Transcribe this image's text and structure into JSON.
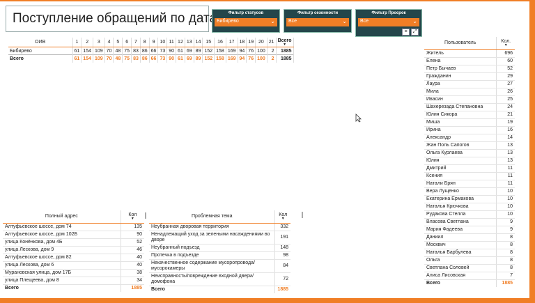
{
  "title": "Поступление обращений по датам",
  "filters": [
    {
      "label": "Фильтр статусов",
      "value": "Бибирево"
    },
    {
      "label": "Фильтр сезонности",
      "value": "Все"
    },
    {
      "label": "Фильтр Просрок",
      "value": "Все"
    }
  ],
  "main_table": {
    "row_header": "ОИВ",
    "columns": [
      "1",
      "2",
      "3",
      "4",
      "5",
      "6",
      "7",
      "8",
      "9",
      "10",
      "11",
      "12",
      "13",
      "14",
      "15",
      "16",
      "17",
      "18",
      "19",
      "20",
      "21",
      "Всего"
    ],
    "rows": [
      {
        "name": "Бибирево",
        "values": [
          "61",
          "154",
          "109",
          "70",
          "48",
          "75",
          "83",
          "86",
          "66",
          "73",
          "90",
          "61",
          "69",
          "89",
          "152",
          "158",
          "169",
          "94",
          "76",
          "100",
          "2",
          "1885"
        ]
      },
      {
        "name": "Всего",
        "values": [
          "61",
          "154",
          "109",
          "70",
          "48",
          "75",
          "83",
          "86",
          "66",
          "73",
          "90",
          "61",
          "69",
          "89",
          "152",
          "158",
          "169",
          "94",
          "76",
          "100",
          "2",
          "1885"
        ]
      }
    ]
  },
  "users_table": {
    "headers": [
      "Пользователь",
      "Кол."
    ],
    "rows": [
      [
        "Житель",
        "696"
      ],
      [
        "Елена",
        "60"
      ],
      [
        "Петр Бычаев",
        "52"
      ],
      [
        "Гражданин",
        "29"
      ],
      [
        "Лаура",
        "27"
      ],
      [
        "Мила",
        "26"
      ],
      [
        "Ивасин",
        "25"
      ],
      [
        "Шахерезада Степановна",
        "24"
      ],
      [
        "Юлия Сикора",
        "21"
      ],
      [
        "Миша",
        "19"
      ],
      [
        "Ирина",
        "16"
      ],
      [
        "Александр",
        "14"
      ],
      [
        "Жан Поль Сапогов",
        "13"
      ],
      [
        "Ольга Курлаева",
        "13"
      ],
      [
        "Юлия",
        "13"
      ],
      [
        "Дмитрий",
        "11"
      ],
      [
        "Ксения",
        "11"
      ],
      [
        "Натали Брян",
        "11"
      ],
      [
        "Вера Лущенко",
        "10"
      ],
      [
        "Екатерина Ермакова",
        "10"
      ],
      [
        "Наталья Крючкова",
        "10"
      ],
      [
        "Рудакова Стелла",
        "10"
      ],
      [
        "Власова Светлана",
        "9"
      ],
      [
        "Мария Фадеева",
        "9"
      ],
      [
        "Даниил",
        "8"
      ],
      [
        "Москвич",
        "8"
      ],
      [
        "Наталья Барбулева",
        "8"
      ],
      [
        "Ольга",
        "8"
      ],
      [
        "Светлана Соловей",
        "8"
      ],
      [
        "Алиса Лисовская",
        "7"
      ]
    ],
    "total": [
      "Всего",
      "1885"
    ]
  },
  "address_table": {
    "headers": [
      "Полный адрес",
      "Кол"
    ],
    "rows": [
      [
        "Алтуфьевское шоссе, дом 74",
        "135"
      ],
      [
        "Алтуфьевское шоссе, дом 102Б",
        "90"
      ],
      [
        "улица Конёнкова, дом 4Б",
        "52"
      ],
      [
        "улица Лескова, дом 9",
        "46"
      ],
      [
        "Алтуфьевское шоссе, дом 82",
        "40"
      ],
      [
        "улица Лескова, дом 6",
        "40"
      ],
      [
        "Мурановская улица, дом 17Б",
        "38"
      ],
      [
        "улица Плещеева, дом 8",
        "34"
      ]
    ],
    "total": [
      "Всего",
      "1885"
    ]
  },
  "topic_table": {
    "headers": [
      "Проблемная тема",
      "Кол"
    ],
    "rows": [
      [
        "Неубранная дворовая территория",
        "332"
      ],
      [
        "Ненадлежащий уход за зелеными насаждениями во дворе",
        "191"
      ],
      [
        "Неубранный подъезд",
        "148"
      ],
      [
        "Протечка в подъезде",
        "98"
      ],
      [
        "Некачественное содержание мусоропровода/мусорокамеры",
        "84"
      ],
      [
        "Неисправность/повреждение входной двери/домофона",
        "72"
      ]
    ],
    "total": [
      "Всего",
      "1885"
    ]
  },
  "colors": {
    "accent": "#f07e26",
    "filter_bg": "#24464b"
  }
}
